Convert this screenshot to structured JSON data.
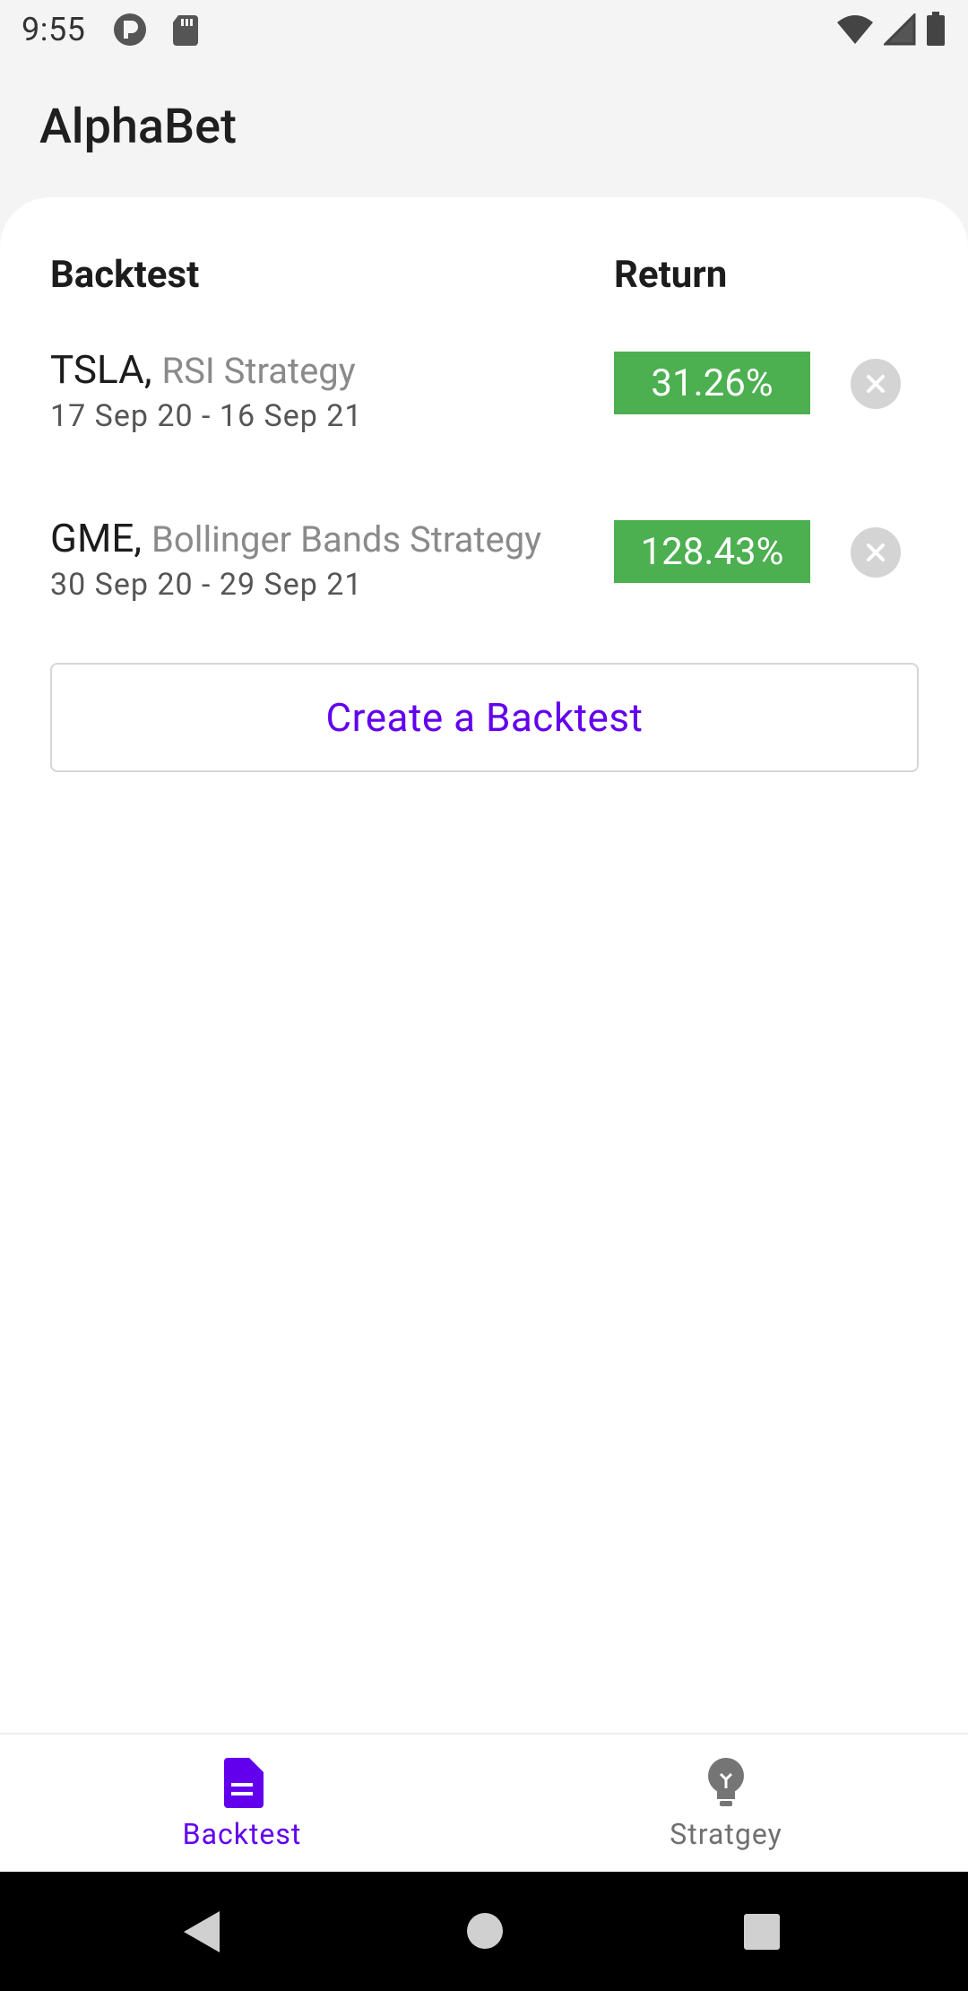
{
  "status_bar": {
    "time": "9:55"
  },
  "app": {
    "title": "AlphaBet"
  },
  "table": {
    "header_backtest": "Backtest",
    "header_return": "Return",
    "rows": [
      {
        "ticker": "TSLA,",
        "strategy": "RSI Strategy",
        "dates": "17 Sep 20 - 16 Sep 21",
        "return": "31.26%"
      },
      {
        "ticker": "GME,",
        "strategy": "Bollinger Bands Strategy",
        "dates": "30 Sep 20 - 29 Sep 21",
        "return": "128.43%"
      }
    ]
  },
  "create_button": {
    "label": "Create a Backtest"
  },
  "bottom_nav": {
    "items": [
      {
        "label": "Backtest",
        "icon": "document-icon",
        "active": true
      },
      {
        "label": "Stratgey",
        "icon": "lightbulb-icon",
        "active": false
      }
    ]
  },
  "colors": {
    "accent": "#6200ee",
    "return_positive": "#4caf50"
  }
}
